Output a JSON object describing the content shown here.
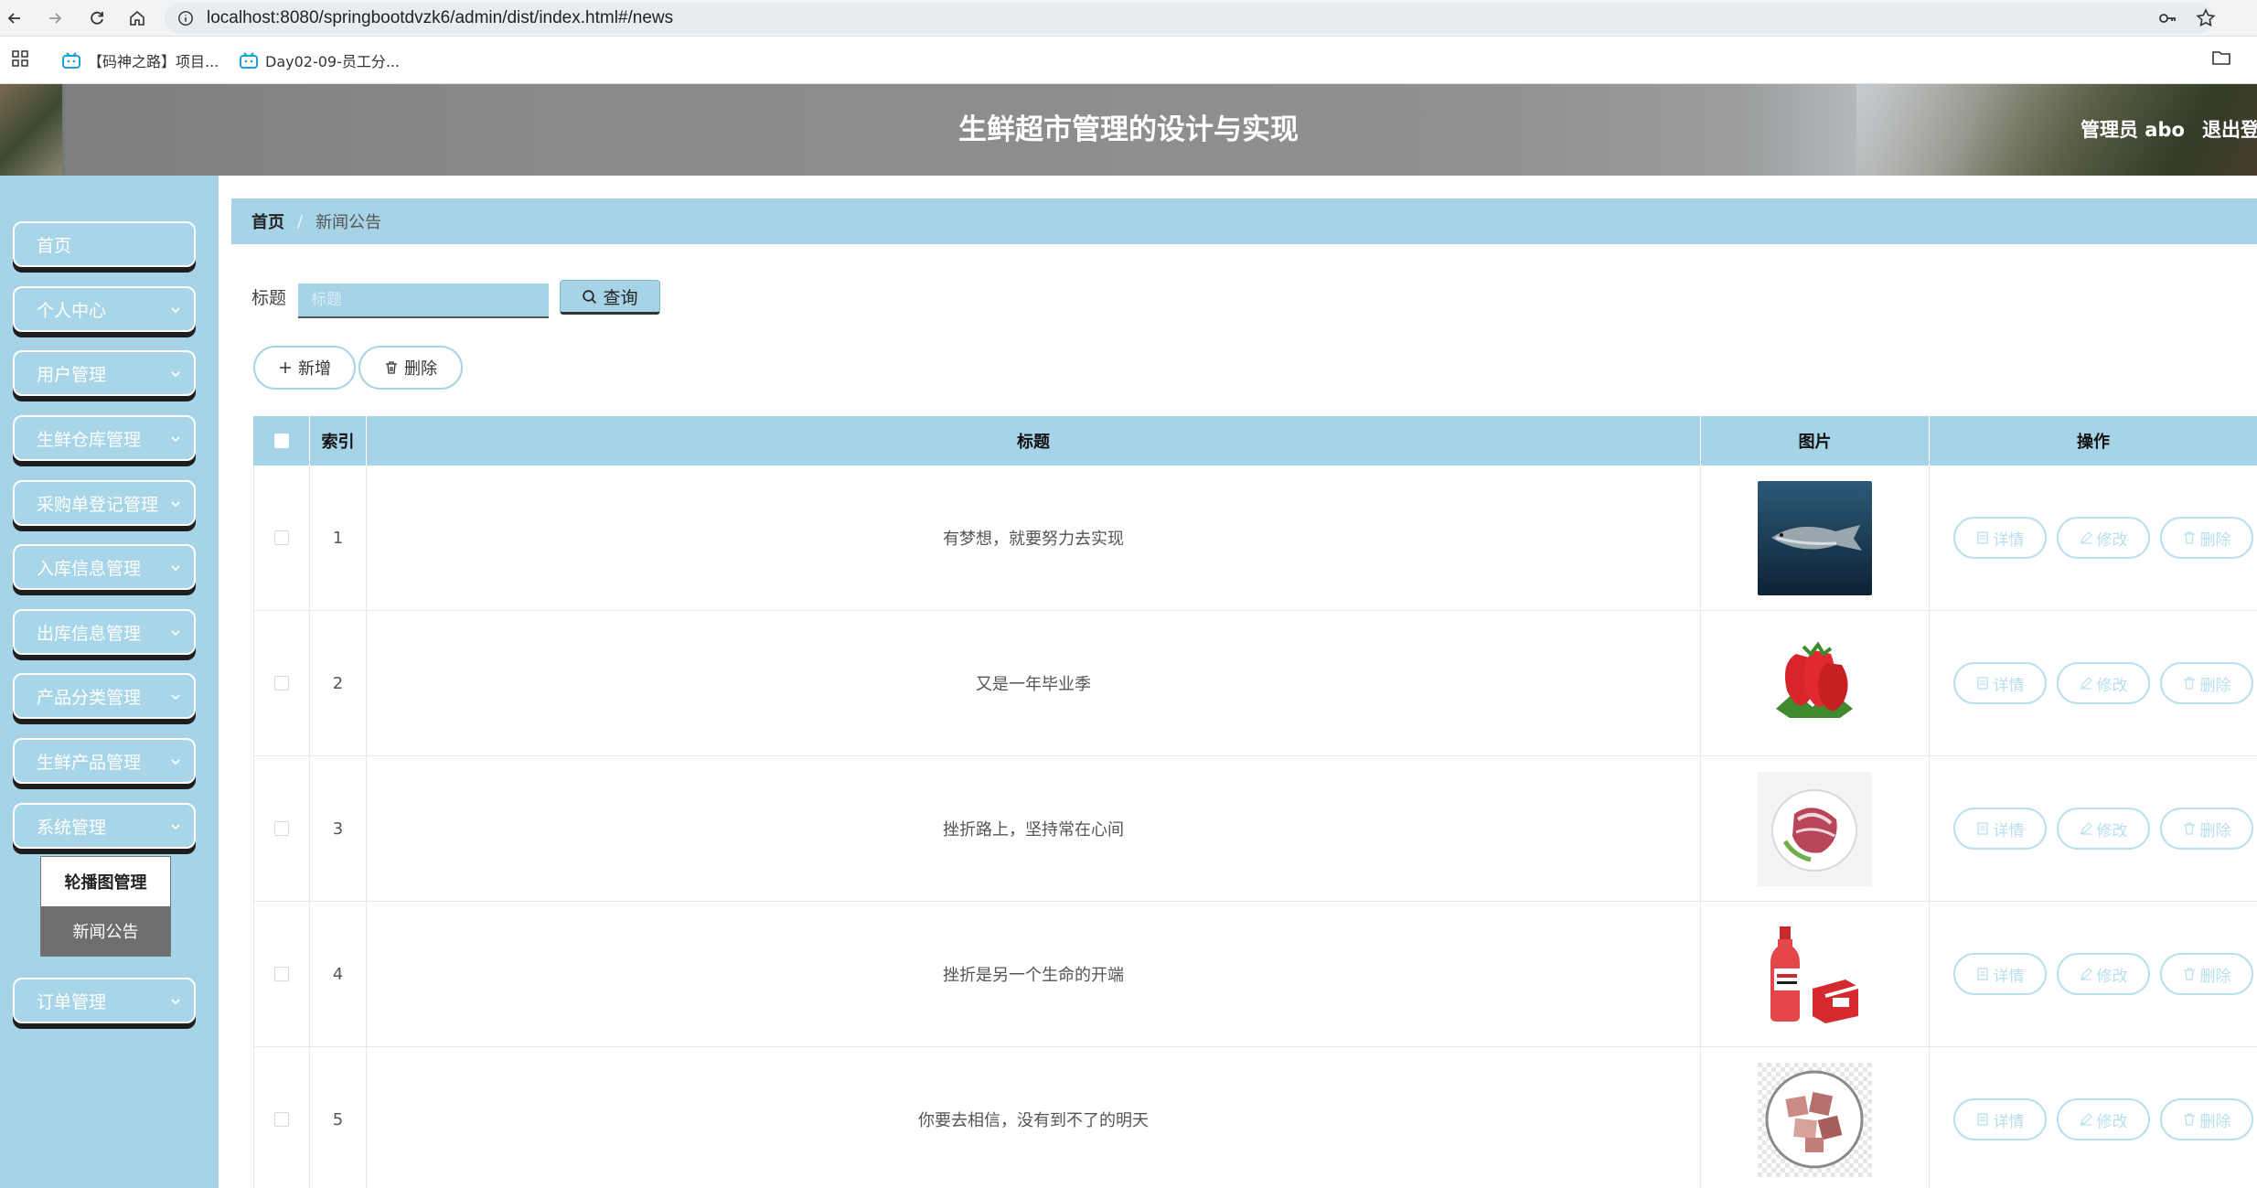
{
  "browser": {
    "url": "localhost:8080/springbootdvzk6/admin/dist/index.html#/news",
    "bookmarks": [
      {
        "label": "【码神之路】项目..."
      },
      {
        "label": "Day02-09-员工分..."
      }
    ]
  },
  "header": {
    "title": "生鲜超市管理的设计与实现",
    "user": "管理员 abo",
    "logout": "退出登"
  },
  "sidebar": {
    "items": [
      {
        "label": "首页"
      },
      {
        "label": "个人中心"
      },
      {
        "label": "用户管理"
      },
      {
        "label": "生鲜仓库管理"
      },
      {
        "label": "采购单登记管理"
      },
      {
        "label": "入库信息管理"
      },
      {
        "label": "出库信息管理"
      },
      {
        "label": "产品分类管理"
      },
      {
        "label": "生鲜产品管理"
      },
      {
        "label": "系统管理"
      },
      {
        "label": "订单管理"
      }
    ],
    "submenu": [
      {
        "label": "轮播图管理"
      },
      {
        "label": "新闻公告"
      }
    ]
  },
  "breadcrumb": {
    "home": "首页",
    "separator": "/",
    "current": "新闻公告"
  },
  "search": {
    "label": "标题",
    "placeholder": "标题",
    "button": "查询"
  },
  "actions": {
    "add": "新增",
    "delete": "删除"
  },
  "table": {
    "columns": [
      "索引",
      "标题",
      "图片",
      "操作"
    ],
    "row_actions": {
      "detail": "详情",
      "edit": "修改",
      "delete": "删除"
    },
    "rows": [
      {
        "index": "1",
        "title": "有梦想，就要努力去实现",
        "image": "fish"
      },
      {
        "index": "2",
        "title": "又是一年毕业季",
        "image": "strawberry"
      },
      {
        "index": "3",
        "title": "挫折路上，坚持常在心间",
        "image": "meat-plate"
      },
      {
        "index": "4",
        "title": "挫折是另一个生命的开端",
        "image": "drink-bottle"
      },
      {
        "index": "5",
        "title": "你要去相信，没有到不了的明天",
        "image": "meat-cubes"
      }
    ]
  },
  "colors": {
    "accent": "#a6d4e6",
    "sidebar_bg": "#a6d4e6",
    "action_border": "#b8dfee"
  }
}
